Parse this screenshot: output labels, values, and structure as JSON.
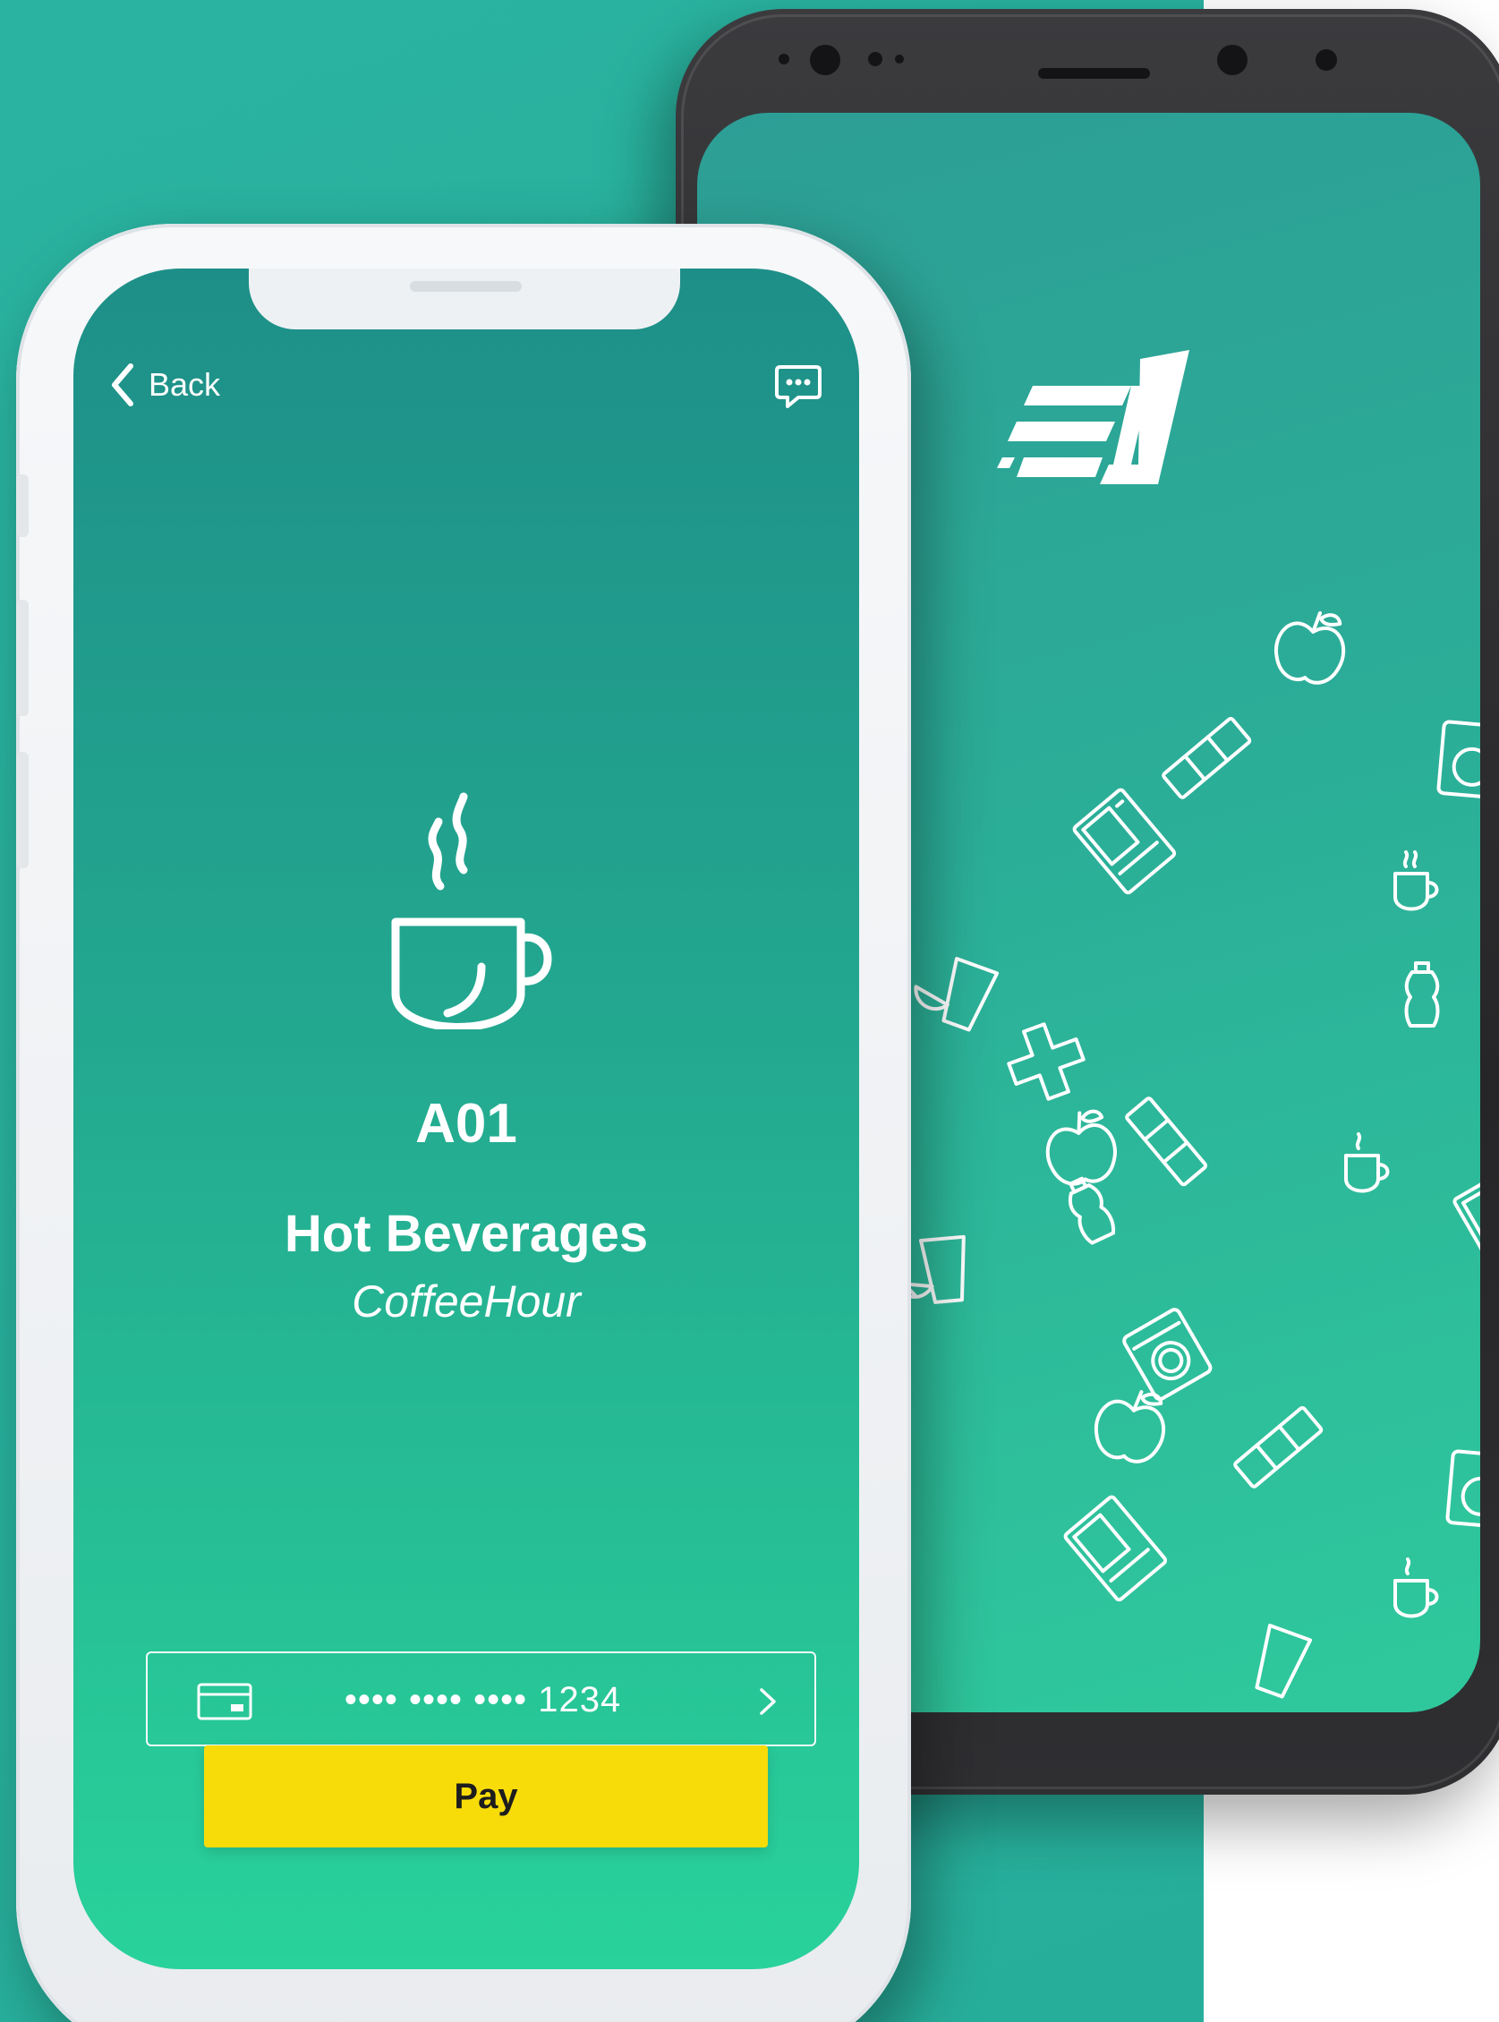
{
  "colors": {
    "background": "#2ab3a0",
    "accent_button": "#f7dc0a",
    "screen_gradient_top": "#1e8f88",
    "screen_gradient_bottom": "#29d29a",
    "text": "#ffffff"
  },
  "iphone_screen": {
    "header": {
      "back_label": "Back",
      "back_icon": "chevron-left-icon",
      "chat_icon": "chat-bubble-icon"
    },
    "product": {
      "icon": "coffee-cup-icon",
      "machine_code": "A01",
      "category": "Hot Beverages",
      "brand": "CoffeeHour"
    },
    "payment": {
      "card_icon": "credit-card-icon",
      "card_number": "•••• •••• •••• 1234",
      "chevron_icon": "chevron-right-icon",
      "pay_label": "Pay"
    }
  },
  "android_screen": {
    "logo_icon": "app-logo-icon",
    "pattern_icons": [
      "apple-icon",
      "juice-glass-icon",
      "washing-machine-icon",
      "coffee-cup-icon",
      "water-bottle-icon",
      "plus-icon",
      "candy-bar-icon",
      "vending-machine-icon"
    ]
  }
}
